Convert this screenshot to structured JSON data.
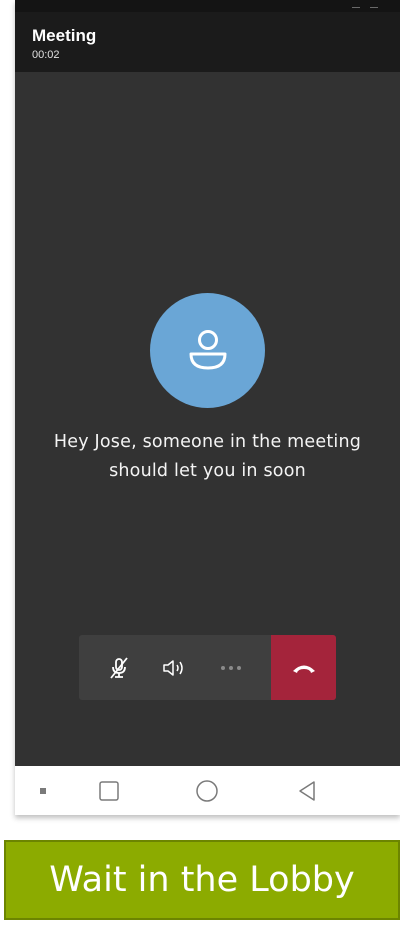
{
  "meeting": {
    "title": "Meeting",
    "duration": "00:02"
  },
  "lobby": {
    "message": "Hey Jose, someone in the meeting should let you in soon"
  },
  "controls": {
    "mute_icon": "microphone-muted-icon",
    "speaker_icon": "speaker-icon",
    "more_icon": "more-options-icon",
    "hangup_icon": "hang-up-phone-icon"
  },
  "navigation": {
    "menu_icon": "menu-dot-icon",
    "recents_icon": "square-icon",
    "home_icon": "circle-icon",
    "back_icon": "triangle-back-icon"
  },
  "caption": {
    "label": "Wait in the Lobby"
  },
  "colors": {
    "header": "#1b1b1b",
    "call_background": "#323232",
    "avatar": "#6aa6d6",
    "hangup": "#a4243b",
    "caption_background": "#8cab00"
  }
}
